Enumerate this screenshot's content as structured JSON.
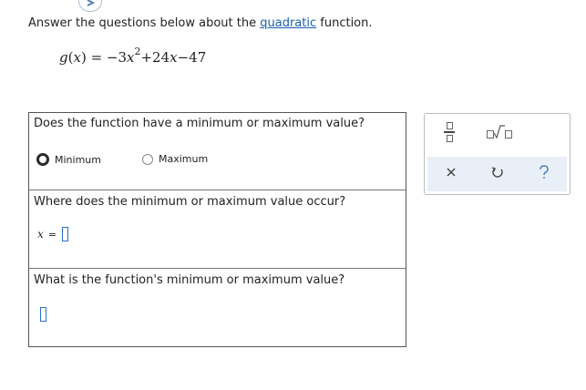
{
  "prompt": {
    "before": "Answer the questions below about the ",
    "link": "quadratic",
    "after": " function."
  },
  "equation": {
    "func": "g",
    "lparen": "(",
    "var": "x",
    "rparen": ")",
    "equals": " = −3",
    "x2": "x",
    "exp": "2",
    "plus": "+24",
    "x1": "x",
    "rest": "−47"
  },
  "q1": {
    "text": "Does the function have a minimum or maximum value?",
    "options": [
      "Minimum",
      "Maximum"
    ],
    "selected": "Minimum"
  },
  "q2": {
    "text": "Where does the minimum or maximum value occur?",
    "var": "x",
    "eq": "=",
    "value": ""
  },
  "q3": {
    "text": "What is the function's minimum or maximum value?",
    "value": ""
  },
  "toolbar": {
    "tools": [
      "fraction-icon",
      "sqrt-icon"
    ],
    "actions": [
      "close-icon",
      "undo-icon",
      "help-icon"
    ]
  },
  "colors": {
    "link": "#1a5fb4",
    "input_border": "#2a6dcc",
    "toolbar_bg": "#e8eff7"
  }
}
